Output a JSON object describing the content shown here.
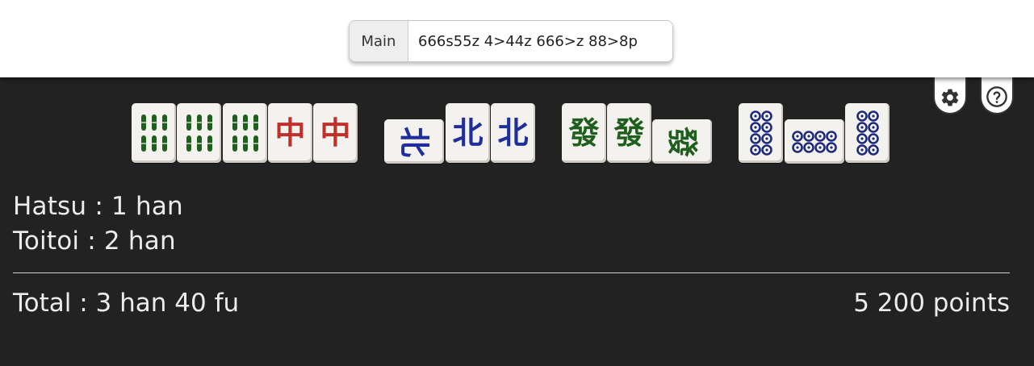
{
  "input": {
    "label": "Main",
    "value": "666s55z 4>44z 666>z 88>8p"
  },
  "buttons": {
    "settings_icon": "gear-icon",
    "help_icon": "question-icon"
  },
  "hand": {
    "closed_tiles": [
      "6s",
      "6s",
      "6s",
      "5z",
      "5z"
    ],
    "melds": [
      [
        "4z",
        "4z",
        "4z"
      ],
      [
        "6z",
        "6z",
        "6z"
      ],
      [
        "8p",
        "8p",
        "8p"
      ]
    ]
  },
  "tile_glyphs": {
    "chun": "中",
    "pei": "北",
    "hatsu": "發"
  },
  "yaku": [
    {
      "text": "Hatsu : 1 han"
    },
    {
      "text": "Toitoi : 2 han"
    }
  ],
  "total": "Total : 3 han 40 fu",
  "points": "5 200 points",
  "colors": {
    "background": "#222222",
    "bamboo_green": "#1e5f1e",
    "chun_red": "#c0302a",
    "wind_blue": "#1f2e9a",
    "pin_blue": "#1e2a7a"
  }
}
